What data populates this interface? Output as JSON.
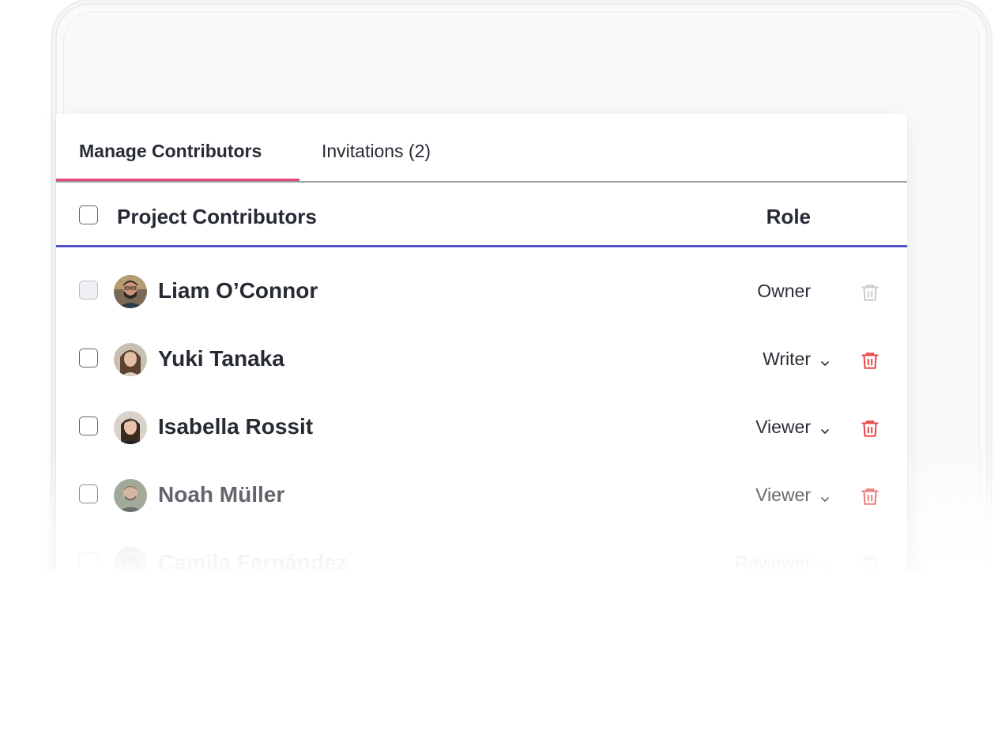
{
  "tabs": {
    "manage_label": "Manage Contributors",
    "invitations_label": "Invitations (2)"
  },
  "table": {
    "header_title": "Project Contributors",
    "header_role": "Role"
  },
  "colors": {
    "active_tab_underline": "#e6467f",
    "header_divider": "#5452cf",
    "delete_icon": "#e84a4a",
    "delete_icon_disabled": "#c7cbd1",
    "text_primary": "#262a33"
  },
  "contributors": [
    {
      "name": "Liam O’Connor",
      "role": "Owner",
      "role_editable": false,
      "deletable": false,
      "icon": "trash-icon"
    },
    {
      "name": "Yuki Tanaka",
      "role": "Writer",
      "role_editable": true,
      "deletable": true,
      "icon": "trash-icon"
    },
    {
      "name": "Isabella Rossit",
      "role": "Viewer",
      "role_editable": true,
      "deletable": true,
      "icon": "trash-icon"
    },
    {
      "name": "Noah Müller",
      "role": "Viewer",
      "role_editable": true,
      "deletable": true,
      "icon": "trash-icon"
    },
    {
      "name": "Camila Fernández",
      "role": "Reviewer",
      "role_editable": true,
      "deletable": true,
      "icon": "trash-icon"
    }
  ]
}
